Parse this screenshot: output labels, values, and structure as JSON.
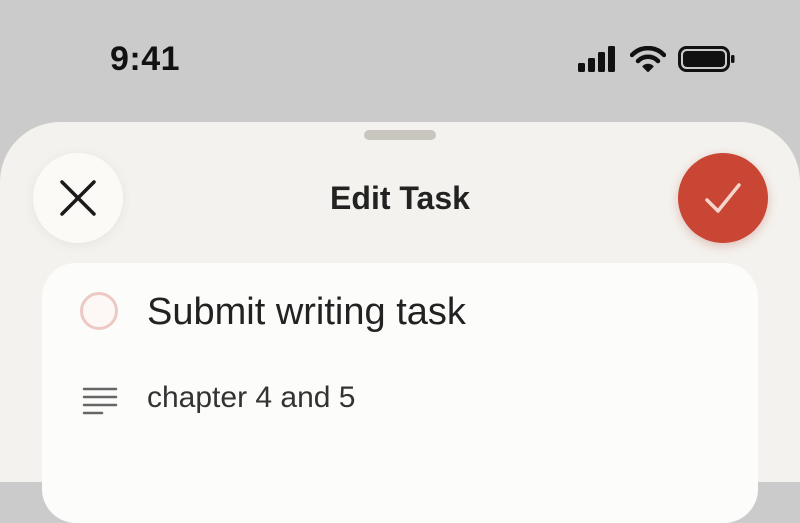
{
  "status_bar": {
    "time": "9:41",
    "icons": [
      "cellular-signal-icon",
      "wifi-icon",
      "battery-icon"
    ]
  },
  "sheet": {
    "title": "Edit Task",
    "close_icon": "close-icon",
    "save_icon": "checkmark-icon"
  },
  "task": {
    "title": "Submit writing task",
    "notes": "chapter 4 and 5",
    "completed": false
  },
  "colors": {
    "accent": "#c94534",
    "sheet_background": "#f4f2ee",
    "card_background": "#fcfcfb",
    "toggle_border": "#ecc9c3",
    "status_background": "#cbcbcb"
  }
}
